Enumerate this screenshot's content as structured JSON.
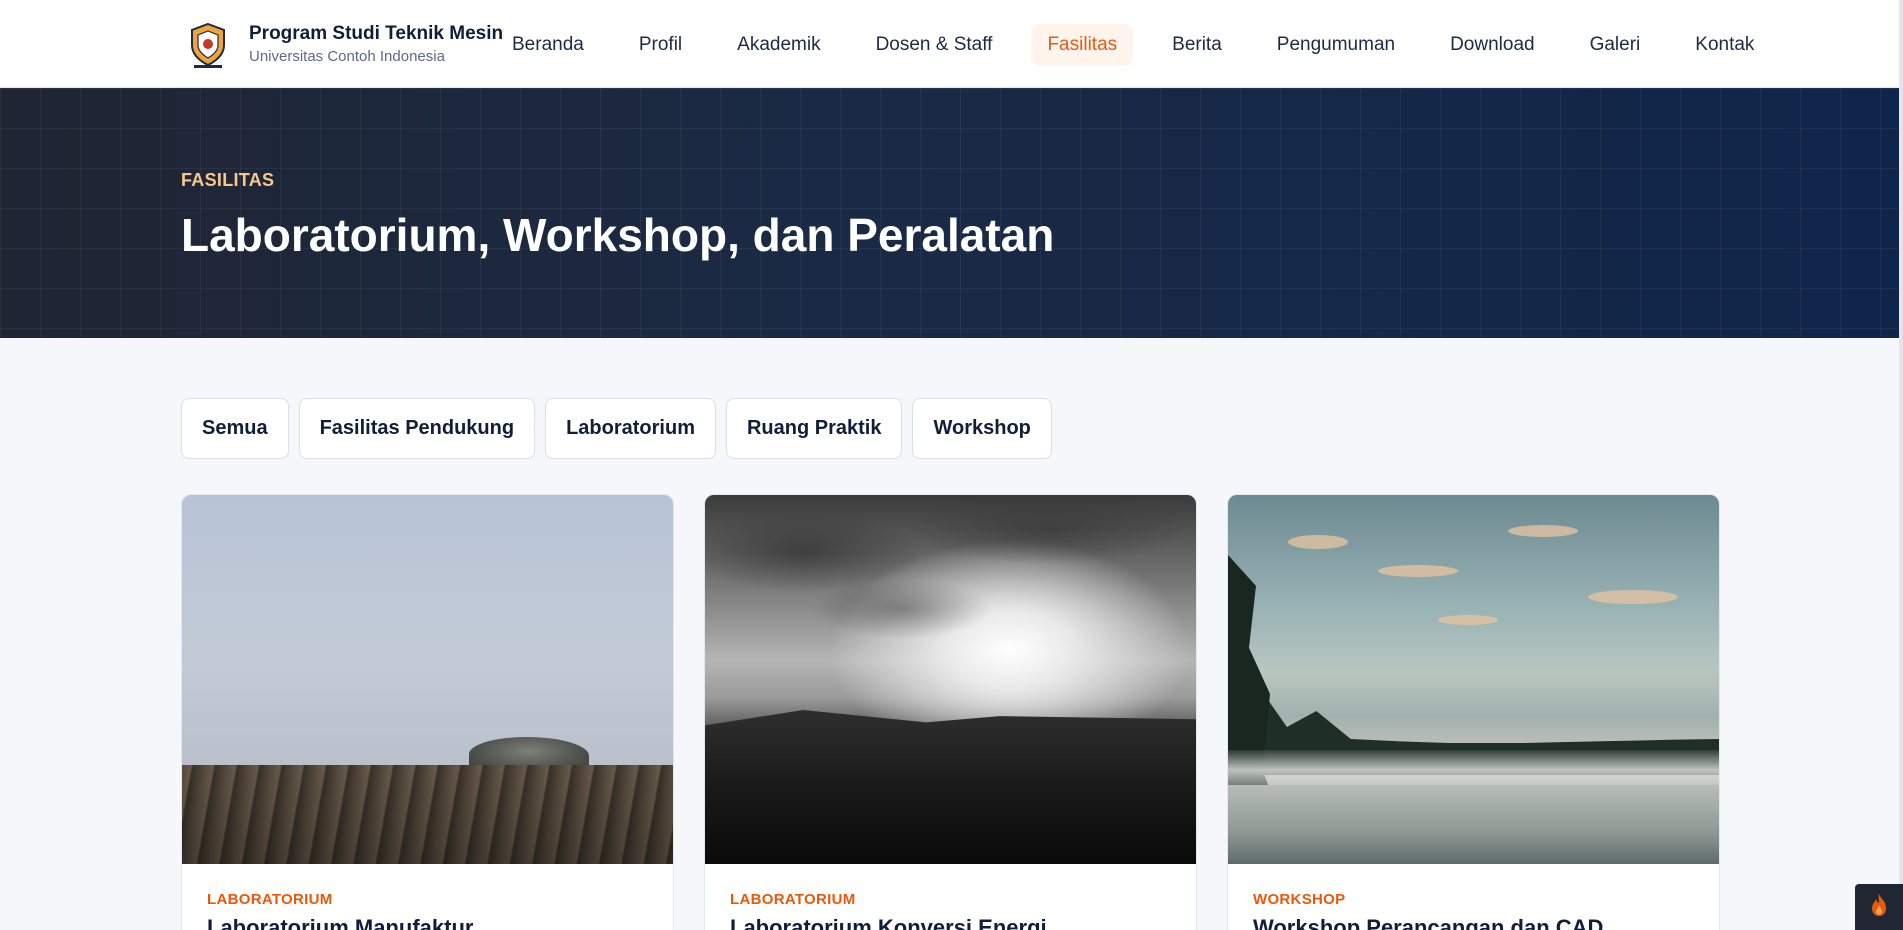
{
  "header": {
    "brand_title": "Program Studi Teknik Mesin",
    "brand_subtitle": "Universitas Contoh Indonesia",
    "nav": [
      {
        "label": "Beranda"
      },
      {
        "label": "Profil"
      },
      {
        "label": "Akademik"
      },
      {
        "label": "Dosen & Staff"
      },
      {
        "label": "Fasilitas",
        "active": true
      },
      {
        "label": "Berita"
      },
      {
        "label": "Pengumuman"
      },
      {
        "label": "Download"
      },
      {
        "label": "Galeri"
      },
      {
        "label": "Kontak"
      }
    ]
  },
  "hero": {
    "kicker": "FASILITAS",
    "title": "Laboratorium, Workshop, dan Peralatan"
  },
  "filters": [
    {
      "label": "Semua"
    },
    {
      "label": "Fasilitas Pendukung"
    },
    {
      "label": "Laboratorium"
    },
    {
      "label": "Ruang Praktik"
    },
    {
      "label": "Workshop"
    }
  ],
  "cards": [
    {
      "category": "LABORATORIUM",
      "title": "Laboratorium Manufaktur"
    },
    {
      "category": "LABORATORIUM",
      "title": "Laboratorium Konversi Energi"
    },
    {
      "category": "WORKSHOP",
      "title": "Workshop Perancangan dan CAD"
    }
  ],
  "icons": {
    "logo": "university-shield-icon",
    "corner": "flame-icon"
  },
  "colors": {
    "accent": "#ea580c",
    "hero_bg": "#10254a",
    "kicker": "#f8c88a"
  }
}
